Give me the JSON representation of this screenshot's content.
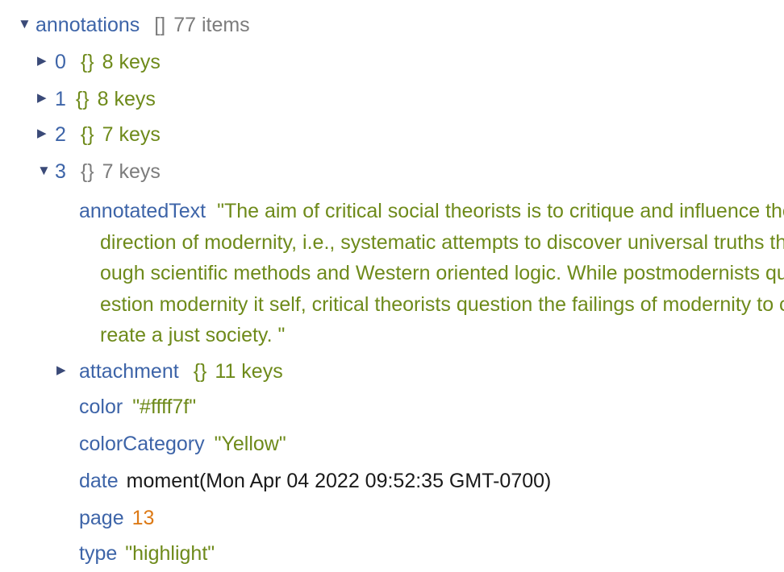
{
  "root": {
    "key": "annotations",
    "type_glyph": "[]",
    "count": "77 items"
  },
  "items": [
    {
      "index": "0",
      "type_glyph": "{}",
      "count": "8 keys"
    },
    {
      "index": "1",
      "type_glyph": "{}",
      "count": "8 keys"
    },
    {
      "index": "2",
      "type_glyph": "{}",
      "count": "7 keys"
    },
    {
      "index": "3",
      "type_glyph": "{}",
      "count": "7 keys"
    }
  ],
  "expanded": {
    "annotatedText": {
      "key": "annotatedText",
      "value": "\"The aim of critical social theorists is to critique and influence the direction of modernity, i.e., systematic attempts to discover universal truths through scientific methods and Western oriented logic. While postmodernists question modernity it self, critical theorists question the failings of modernity to create a just society. \""
    },
    "attachment": {
      "key": "attachment",
      "type_glyph": "{}",
      "count": "11 keys"
    },
    "color": {
      "key": "color",
      "value": "\"#ffff7f\""
    },
    "colorCategory": {
      "key": "colorCategory",
      "value": "\"Yellow\""
    },
    "date": {
      "key": "date",
      "value": "moment(Mon Apr 04 2022 09:52:35 GMT-0700)"
    },
    "page": {
      "key": "page",
      "value": "13"
    },
    "type": {
      "key": "type",
      "value": "\"highlight\""
    }
  },
  "icons": {
    "collapsed": "triangle-right",
    "expanded": "triangle-down"
  },
  "colors": {
    "key": "#3d64a8",
    "string": "#6e8a1a",
    "number": "#dd7a16",
    "muted": "#7c7c7c"
  }
}
